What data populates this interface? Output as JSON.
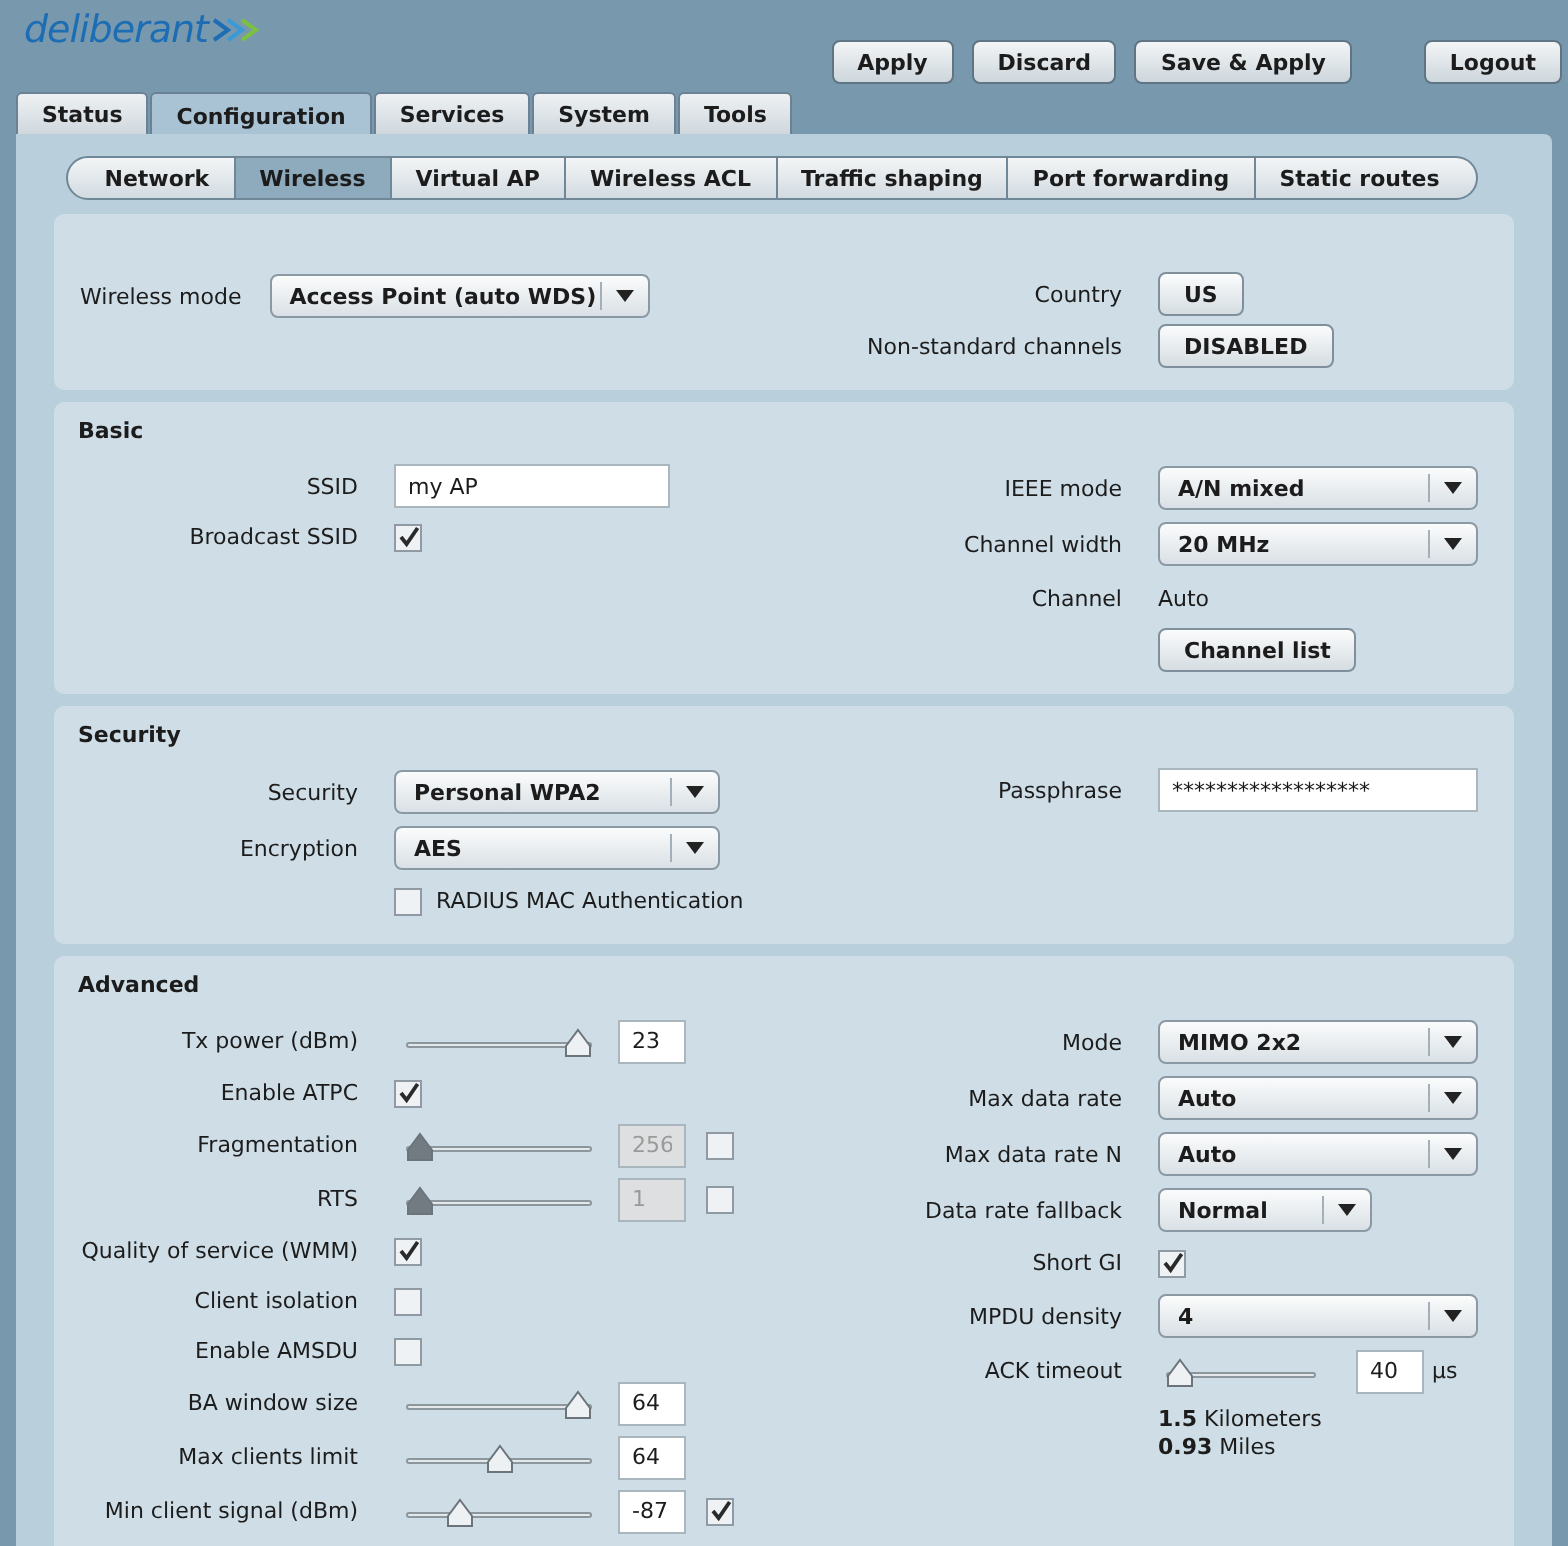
{
  "logo": "deliberant",
  "top_buttons": [
    "Apply",
    "Discard",
    "Save & Apply",
    "Logout"
  ],
  "tabs": [
    {
      "label": "Status",
      "selected": false
    },
    {
      "label": "Configuration",
      "selected": true
    },
    {
      "label": "Services",
      "selected": false
    },
    {
      "label": "System",
      "selected": false
    },
    {
      "label": "Tools",
      "selected": false
    }
  ],
  "subtabs": [
    {
      "label": "Network",
      "selected": false
    },
    {
      "label": "Wireless",
      "selected": true
    },
    {
      "label": "Virtual AP",
      "selected": false
    },
    {
      "label": "Wireless ACL",
      "selected": false
    },
    {
      "label": "Traffic shaping",
      "selected": false
    },
    {
      "label": "Port forwarding",
      "selected": false
    },
    {
      "label": "Static routes",
      "selected": false
    }
  ],
  "mode_section": {
    "wireless_mode": {
      "label": "Wireless mode",
      "value": "Access Point (auto WDS)"
    },
    "right": [
      {
        "label": "Country",
        "kind": "button",
        "text": "US"
      },
      {
        "label": "Non-standard channels",
        "kind": "button",
        "text": "DISABLED"
      }
    ]
  },
  "sections": [
    {
      "title": "Basic",
      "left": [
        {
          "label": "SSID",
          "kind": "text",
          "value": "my AP"
        },
        {
          "label": "Broadcast SSID",
          "kind": "checkbox",
          "checked": true
        }
      ],
      "right": [
        {
          "label": "IEEE mode",
          "kind": "select",
          "value": "A/N mixed"
        },
        {
          "label": "Channel width",
          "kind": "select",
          "value": "20 MHz"
        },
        {
          "label": "Channel",
          "kind": "plain",
          "value": "Auto"
        },
        {
          "kind": "button",
          "text": "Channel list"
        }
      ]
    },
    {
      "title": "Security",
      "left": [
        {
          "label": "Security",
          "kind": "select",
          "value": "Personal WPA2"
        },
        {
          "label": "Encryption",
          "kind": "select",
          "value": "AES"
        },
        {
          "kind": "checkbox",
          "caption": "RADIUS MAC Authentication",
          "checked": false
        }
      ],
      "right": [
        {
          "label": "Passphrase",
          "kind": "text",
          "value": "******************"
        }
      ]
    },
    {
      "title": "Advanced",
      "left": [
        {
          "label": "Tx power (dBm)",
          "kind": "slider",
          "level": 1,
          "value": "23",
          "disabled": false
        },
        {
          "label": "Enable ATPC",
          "kind": "checkbox",
          "checked": true
        },
        {
          "label": "Fragmentation",
          "kind": "slider",
          "level": 0,
          "value": "256",
          "disabled": true,
          "checked": false
        },
        {
          "label": "RTS",
          "kind": "slider",
          "level": 0,
          "value": "1",
          "disabled": true,
          "checked": false
        },
        {
          "label": "Quality of service (WMM)",
          "kind": "checkbox",
          "checked": true
        },
        {
          "label": "Client isolation",
          "kind": "checkbox",
          "checked": false
        },
        {
          "label": "Enable AMSDU",
          "kind": "checkbox",
          "checked": false
        },
        {
          "label": "BA window size",
          "kind": "slider",
          "level": 1,
          "value": "64",
          "disabled": false
        },
        {
          "label": "Max clients limit",
          "kind": "slider",
          "level": 0.5,
          "value": "64",
          "disabled": false
        },
        {
          "label": "Min client signal (dBm)",
          "kind": "slider",
          "level": 0.25,
          "value": "-87",
          "disabled": false,
          "checked": true
        }
      ],
      "right": [
        {
          "label": "Mode",
          "kind": "select",
          "value": "MIMO 2x2"
        },
        {
          "label": "Max data rate",
          "kind": "select",
          "value": "Auto"
        },
        {
          "label": "Max data rate N",
          "kind": "select",
          "value": "Auto"
        },
        {
          "label": "Data rate fallback",
          "kind": "short_select",
          "value": "Normal"
        },
        {
          "label": "Short GI",
          "kind": "checkbox",
          "checked": true
        },
        {
          "label": "MPDU density",
          "kind": "select",
          "value": "4"
        },
        {
          "label": "ACK timeout",
          "kind": "slider",
          "level": 0,
          "value": "40",
          "disabled": false,
          "unit": "µs"
        },
        {
          "kind": "readout",
          "lines": [
            "**1.5** Kilometers",
            "**0.93** Miles"
          ]
        }
      ]
    }
  ]
}
